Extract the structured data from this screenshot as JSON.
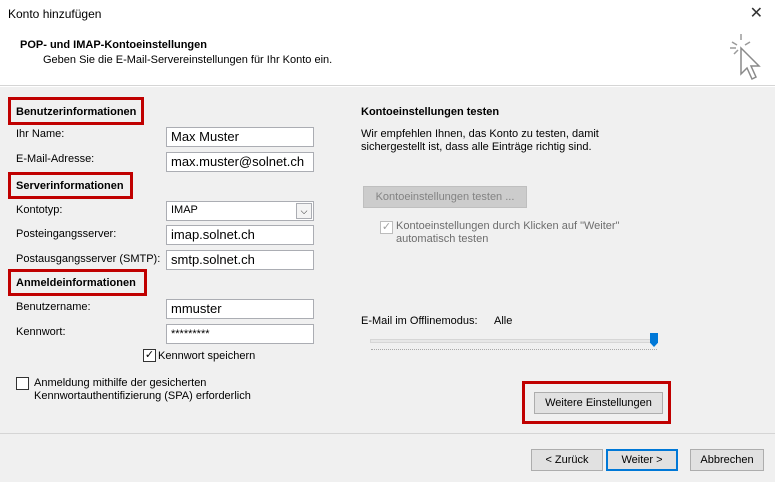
{
  "window": {
    "title": "Konto hinzufügen",
    "close_glyph": "✕"
  },
  "header": {
    "title": "POP- und IMAP-Kontoeinstellungen",
    "subtitle": "Geben Sie die E-Mail-Servereinstellungen für Ihr Konto ein.",
    "icon": "cursor-click-icon"
  },
  "user_info": {
    "heading": "Benutzerinformationen",
    "name_label": "Ihr Name:",
    "name_value": "Max Muster",
    "email_label": "E-Mail-Adresse:",
    "email_value": "max.muster@solnet.ch"
  },
  "server_info": {
    "heading": "Serverinformationen",
    "account_type_label": "Kontotyp:",
    "account_type_value": "IMAP",
    "incoming_label": "Posteingangsserver:",
    "incoming_value": "imap.solnet.ch",
    "outgoing_label": "Postausgangsserver (SMTP):",
    "outgoing_value": "smtp.solnet.ch"
  },
  "login_info": {
    "heading": "Anmeldeinformationen",
    "username_label": "Benutzername:",
    "username_value": "mmuster",
    "password_label": "Kennwort:",
    "password_value": "*********",
    "remember_label": "Kennwort speichern",
    "remember_checked": true,
    "spa_label_line1": "Anmeldung mithilfe der gesicherten",
    "spa_label_line2": "Kennwortauthentifizierung (SPA) erforderlich",
    "spa_checked": false
  },
  "test": {
    "heading": "Kontoeinstellungen testen",
    "description_line1": "Wir empfehlen Ihnen, das Konto zu testen, damit",
    "description_line2": "sichergestellt ist, dass alle Einträge richtig sind.",
    "test_button": "Kontoeinstellungen testen ...",
    "auto_test_line1": "Kontoeinstellungen durch Klicken auf \"Weiter\"",
    "auto_test_line2": "automatisch testen",
    "auto_test_checked": true
  },
  "offline": {
    "label": "E-Mail im Offlinemodus:",
    "value": "Alle",
    "slider_position": 1.0
  },
  "buttons": {
    "more_settings": "Weitere Einstellungen",
    "back": "< Zurück",
    "next": "Weiter >",
    "cancel": "Abbrechen"
  },
  "colors": {
    "highlight_red": "#c00000",
    "default_button_border": "#0078d7",
    "slider_thumb": "#0078d7"
  }
}
